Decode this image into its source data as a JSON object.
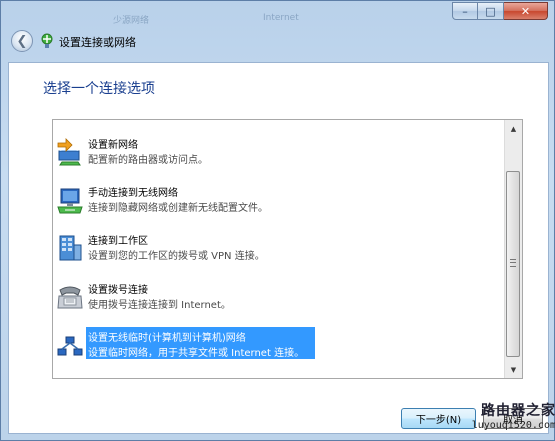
{
  "window": {
    "background_labels": [
      "少源网络",
      "Internet"
    ],
    "caption_buttons": {
      "minimize": "–",
      "maximize": "□",
      "close": "✕"
    }
  },
  "nav": {
    "back_icon": "back-arrow-icon",
    "title_icon": "network-wizard-icon",
    "title": "设置连接或网络"
  },
  "page": {
    "heading": "选择一个连接选项"
  },
  "options": [
    {
      "title": "设置新网络",
      "description": "配置新的路由器或访问点。",
      "icon": "new-network-icon",
      "selected": false
    },
    {
      "title": "手动连接到无线网络",
      "description": "连接到隐藏网络或创建新无线配置文件。",
      "icon": "wireless-network-icon",
      "selected": false
    },
    {
      "title": "连接到工作区",
      "description": "设置到您的工作区的拨号或 VPN 连接。",
      "icon": "workplace-icon",
      "selected": false
    },
    {
      "title": "设置拨号连接",
      "description": "使用拨号连接连接到 Internet。",
      "icon": "dialup-phone-icon",
      "selected": false
    },
    {
      "title": "设置无线临时(计算机到计算机)网络",
      "description": "设置临时网络，用于共享文件或 Internet 连接。",
      "icon": "adhoc-network-icon",
      "selected": true
    }
  ],
  "buttons": {
    "next": "下一步(N)",
    "cancel": "取消"
  },
  "watermark": {
    "brand": "路由器之家",
    "url": "luyouqi520.com"
  },
  "colors": {
    "selection": "#3399ff",
    "heading": "#1a3f8f"
  }
}
